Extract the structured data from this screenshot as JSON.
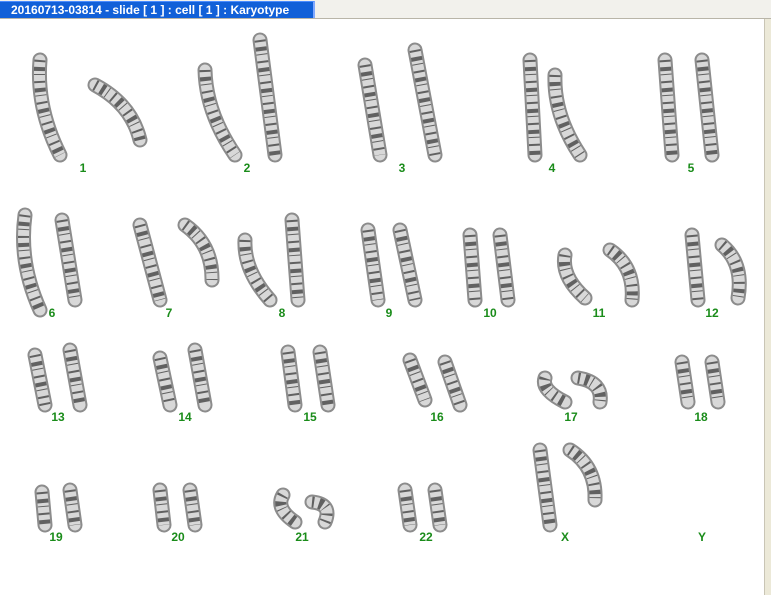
{
  "window": {
    "title": "20160713-03814 - slide [ 1 ] : cell [ 1 ] : Karyotype"
  },
  "karyotype": {
    "label_color": "#1a8c1a",
    "chromosomes": [
      "1",
      "2",
      "3",
      "4",
      "5",
      "6",
      "7",
      "8",
      "9",
      "10",
      "11",
      "12",
      "13",
      "14",
      "15",
      "16",
      "17",
      "18",
      "19",
      "20",
      "21",
      "22",
      "X",
      "Y"
    ],
    "present_count": {
      "X": 2,
      "Y": 0
    }
  }
}
